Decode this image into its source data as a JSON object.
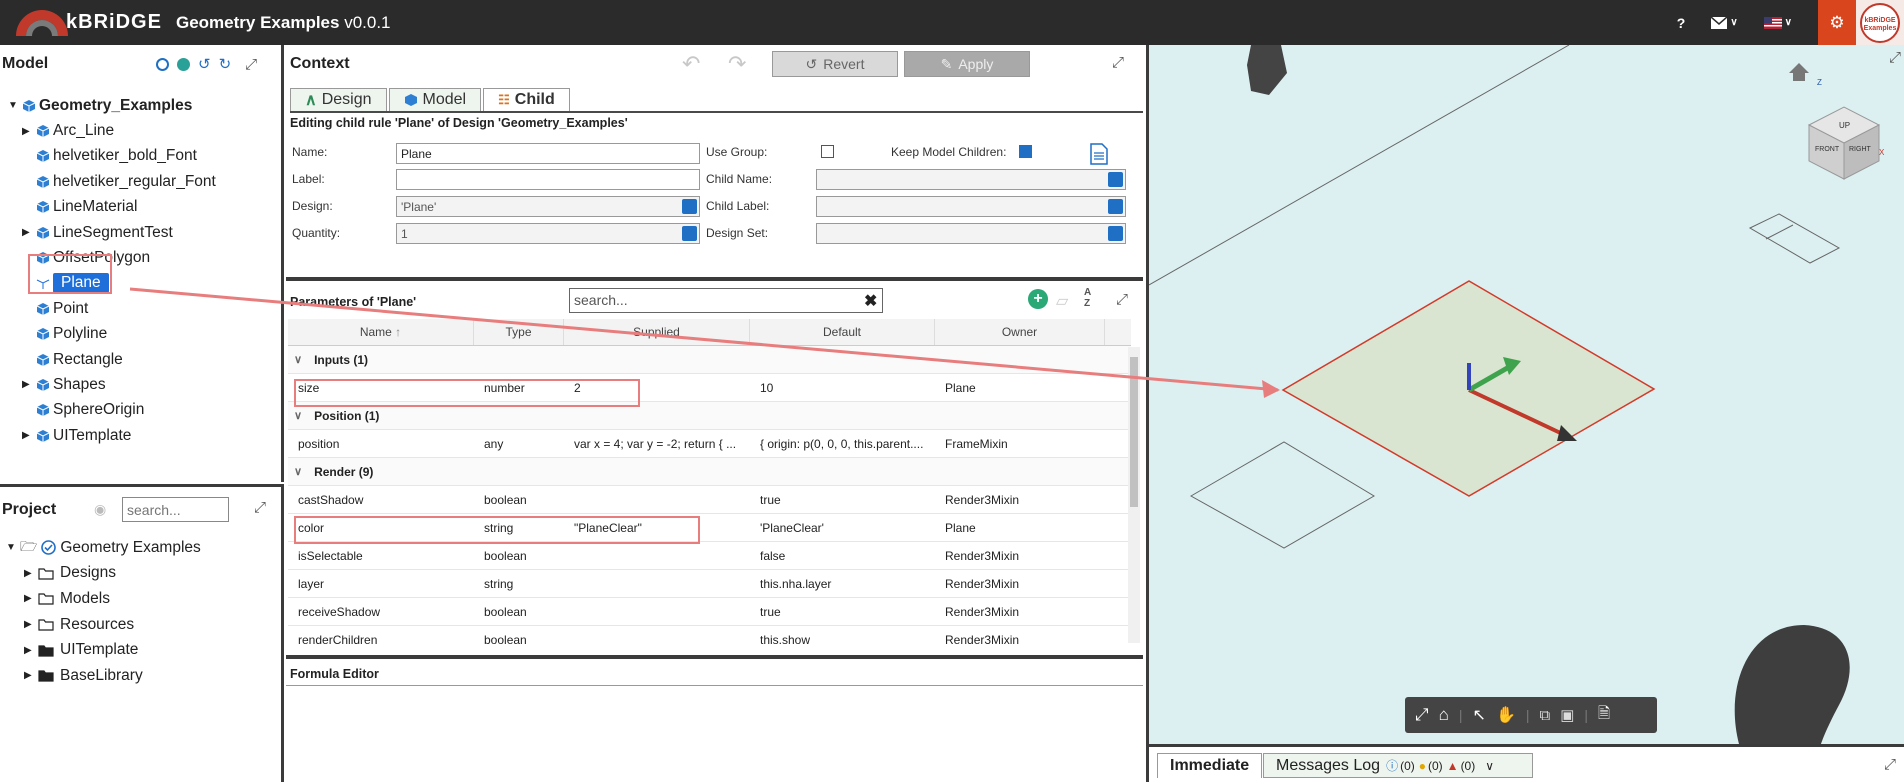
{
  "app": {
    "logo_text": "kBRiDGE",
    "title": "Geometry Examples",
    "version": "v0.0.1"
  },
  "topbar": {
    "help": "?",
    "avatar_text": "kBRiDGE Examples"
  },
  "model": {
    "title": "Model",
    "root": "Geometry_Examples",
    "items": [
      {
        "label": "Arc_Line",
        "expandable": true
      },
      {
        "label": "helvetiker_bold_Font",
        "expandable": false
      },
      {
        "label": "helvetiker_regular_Font",
        "expandable": false
      },
      {
        "label": "LineMaterial",
        "expandable": false
      },
      {
        "label": "LineSegmentTest",
        "expandable": true
      },
      {
        "label": "OffsetPolygon",
        "expandable": false
      },
      {
        "label": "Plane",
        "expandable": false,
        "selected": true
      },
      {
        "label": "Point",
        "expandable": false
      },
      {
        "label": "Polyline",
        "expandable": false
      },
      {
        "label": "Rectangle",
        "expandable": false
      },
      {
        "label": "Shapes",
        "expandable": true
      },
      {
        "label": "SphereOrigin",
        "expandable": false
      },
      {
        "label": "UITemplate",
        "expandable": true
      }
    ]
  },
  "project": {
    "title": "Project",
    "search_placeholder": "search...",
    "root": "Geometry Examples",
    "items": [
      "Designs",
      "Models",
      "Resources",
      "UITemplate",
      "BaseLibrary"
    ]
  },
  "context": {
    "title": "Context",
    "revert": "Revert",
    "apply": "Apply",
    "tabs": [
      "Design",
      "Model",
      "Child"
    ],
    "editing": "Editing child rule 'Plane' of Design 'Geometry_Examples'",
    "labels": {
      "name": "Name:",
      "label": "Label:",
      "design": "Design:",
      "quantity": "Quantity:",
      "use_group": "Use Group:",
      "keep_children": "Keep Model Children:",
      "child_name": "Child Name:",
      "child_label": "Child Label:",
      "design_set": "Design Set:"
    },
    "values": {
      "name": "Plane",
      "label": "",
      "design": "'Plane'",
      "quantity": "1"
    }
  },
  "params": {
    "title": "Parameters of 'Plane'",
    "search_placeholder": "search...",
    "columns": [
      "Name",
      "Type",
      "Supplied",
      "Default",
      "Owner"
    ],
    "sort_arrow": "↑",
    "groups": [
      {
        "label": "Inputs (1)",
        "rows": [
          {
            "name": "size",
            "type": "number",
            "supplied": "2",
            "default": "10",
            "owner": "Plane"
          }
        ]
      },
      {
        "label": "Position (1)",
        "rows": [
          {
            "name": "position",
            "type": "any",
            "supplied": "var x = 4; var y = -2; return { ...",
            "default": "{ origin: p(0, 0, 0, this.parent....",
            "owner": "FrameMixin"
          }
        ]
      },
      {
        "label": "Render (9)",
        "rows": [
          {
            "name": "castShadow",
            "type": "boolean",
            "supplied": "",
            "default": "true",
            "owner": "Render3Mixin"
          },
          {
            "name": "color",
            "type": "string",
            "supplied": "\"PlaneClear\"",
            "default": "'PlaneClear'",
            "owner": "Plane"
          },
          {
            "name": "isSelectable",
            "type": "boolean",
            "supplied": "",
            "default": "false",
            "owner": "Render3Mixin"
          },
          {
            "name": "layer",
            "type": "string",
            "supplied": "",
            "default": "this.nha.layer",
            "owner": "Render3Mixin"
          },
          {
            "name": "receiveShadow",
            "type": "boolean",
            "supplied": "",
            "default": "true",
            "owner": "Render3Mixin"
          },
          {
            "name": "renderChildren",
            "type": "boolean",
            "supplied": "",
            "default": "this.show",
            "owner": "Render3Mixin"
          }
        ]
      }
    ]
  },
  "formula": {
    "title": "Formula Editor"
  },
  "viewport": {
    "cube_labels": [
      "UP",
      "FRONT",
      "RIGHT"
    ],
    "axis_labels": [
      "Z",
      "X"
    ]
  },
  "bottom_tabs": {
    "immediate": "Immediate",
    "messages": "Messages Log",
    "info_count": "(0)",
    "warn_count": "(0)",
    "error_count": "(0)"
  },
  "colors": {
    "topbar": "#2b2b2b",
    "selected": "#1e6fd9",
    "accent": "#d9451d",
    "annotation": "#e87d7d",
    "viewport_bg": "#dcf0f2"
  }
}
